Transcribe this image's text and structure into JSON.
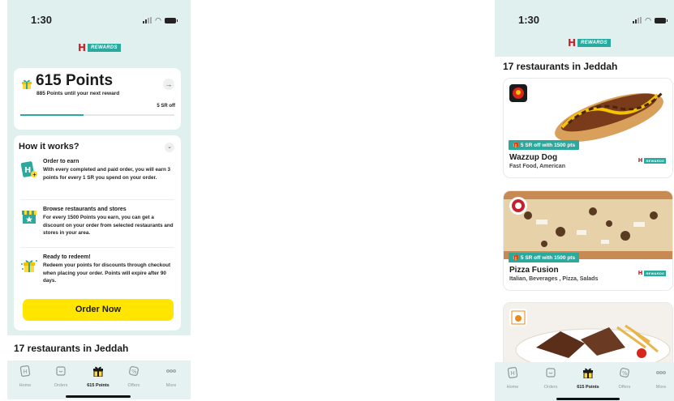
{
  "status_bar": {
    "time": "1:30"
  },
  "brand": {
    "letter": "H",
    "rewards": "REWARDS"
  },
  "points_card": {
    "title": "615 Points",
    "subtitle": "885 Points until your next reward",
    "reward_label": "5 SR off",
    "progress_fraction": 0.41
  },
  "how_it_works": {
    "title": "How it works?",
    "steps": [
      {
        "title": "Order to earn",
        "desc": "With every completed and paid order, you will earn 3 points for every 1 SR you spend on your order."
      },
      {
        "title": "Browse restaurants and stores",
        "desc": "For every 1500 Points you earn, you can get a discount on your order from selected restaurants and stores in your area."
      },
      {
        "title": "Ready to redeem!",
        "desc": "Redeem your points for discounts through checkout when placing your order. Points will expire after 90 days."
      }
    ],
    "cta": "Order Now"
  },
  "restaurants_heading": "17 restaurants in Jeddah",
  "restaurants": [
    {
      "name": "Wazzup Dog",
      "categories": "Fast Food, American",
      "badge": "5 SR off with 1500 pts"
    },
    {
      "name": "Pizza Fusion",
      "categories": "Italian, Beverages , Pizza, Salads",
      "badge": "5 SR off with 1500 pts"
    },
    {
      "name": "",
      "categories": "",
      "badge": ""
    }
  ],
  "tabbar": {
    "items": [
      {
        "label": "Home",
        "icon": "home-icon"
      },
      {
        "label": "Orders",
        "icon": "orders-icon"
      },
      {
        "label": "615 Points",
        "icon": "gift-icon",
        "active": true
      },
      {
        "label": "Offers",
        "icon": "offers-icon"
      },
      {
        "label": "More",
        "icon": "more-icon"
      }
    ]
  },
  "colors": {
    "teal": "#2aa99e",
    "mint_bg": "#dff0ef",
    "yellow": "#ffe500",
    "brand_red": "#c8202b"
  }
}
